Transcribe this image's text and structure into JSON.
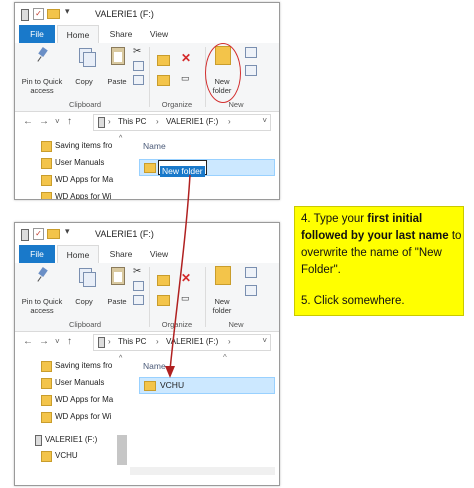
{
  "top_window": {
    "title": "VALERIE1 (F:)",
    "tabs": [
      "File",
      "Home",
      "Share",
      "View"
    ],
    "ribbon": {
      "pin_label": "Pin to Quick access",
      "copy_label": "Copy",
      "paste_label": "Paste",
      "new_folder_label": "New folder",
      "groups": [
        "Clipboard",
        "Organize",
        "New"
      ]
    },
    "breadcrumb": [
      "This PC",
      "VALERIE1 (F:)"
    ],
    "nav_items": [
      "Saving items fro",
      "User Manuals",
      "WD Apps for Ma",
      "WD Apps for Wi"
    ],
    "column_header": "Name",
    "editing_name": "New folder"
  },
  "bottom_window": {
    "title": "VALERIE1 (F:)",
    "tabs": [
      "File",
      "Home",
      "Share",
      "View"
    ],
    "ribbon": {
      "pin_label": "Pin to Quick access",
      "copy_label": "Copy",
      "paste_label": "Paste",
      "new_folder_label": "New folder",
      "groups": [
        "Clipboard",
        "Organize",
        "New"
      ]
    },
    "breadcrumb": [
      "This PC",
      "VALERIE1 (F:)"
    ],
    "nav_items": [
      "Saving items fro",
      "User Manuals",
      "WD Apps for Ma",
      "WD Apps for Wi"
    ],
    "nav_drive": "VALERIE1 (F:)",
    "nav_drive_child": "VCHU",
    "column_header": "Name",
    "renamed_folder": "VCHU"
  },
  "instruction": {
    "step4_prefix": "4. Type your ",
    "step4_bold": "first initial followed by your last name",
    "step4_suffix": " to overwrite the name of \"New Folder\".",
    "step5": "5. Click somewhere."
  },
  "colors": {
    "accent": "#1979ca",
    "highlight_note": "#ffff00",
    "annotation_red": "#d32f2f",
    "selection": "#cce8ff"
  }
}
